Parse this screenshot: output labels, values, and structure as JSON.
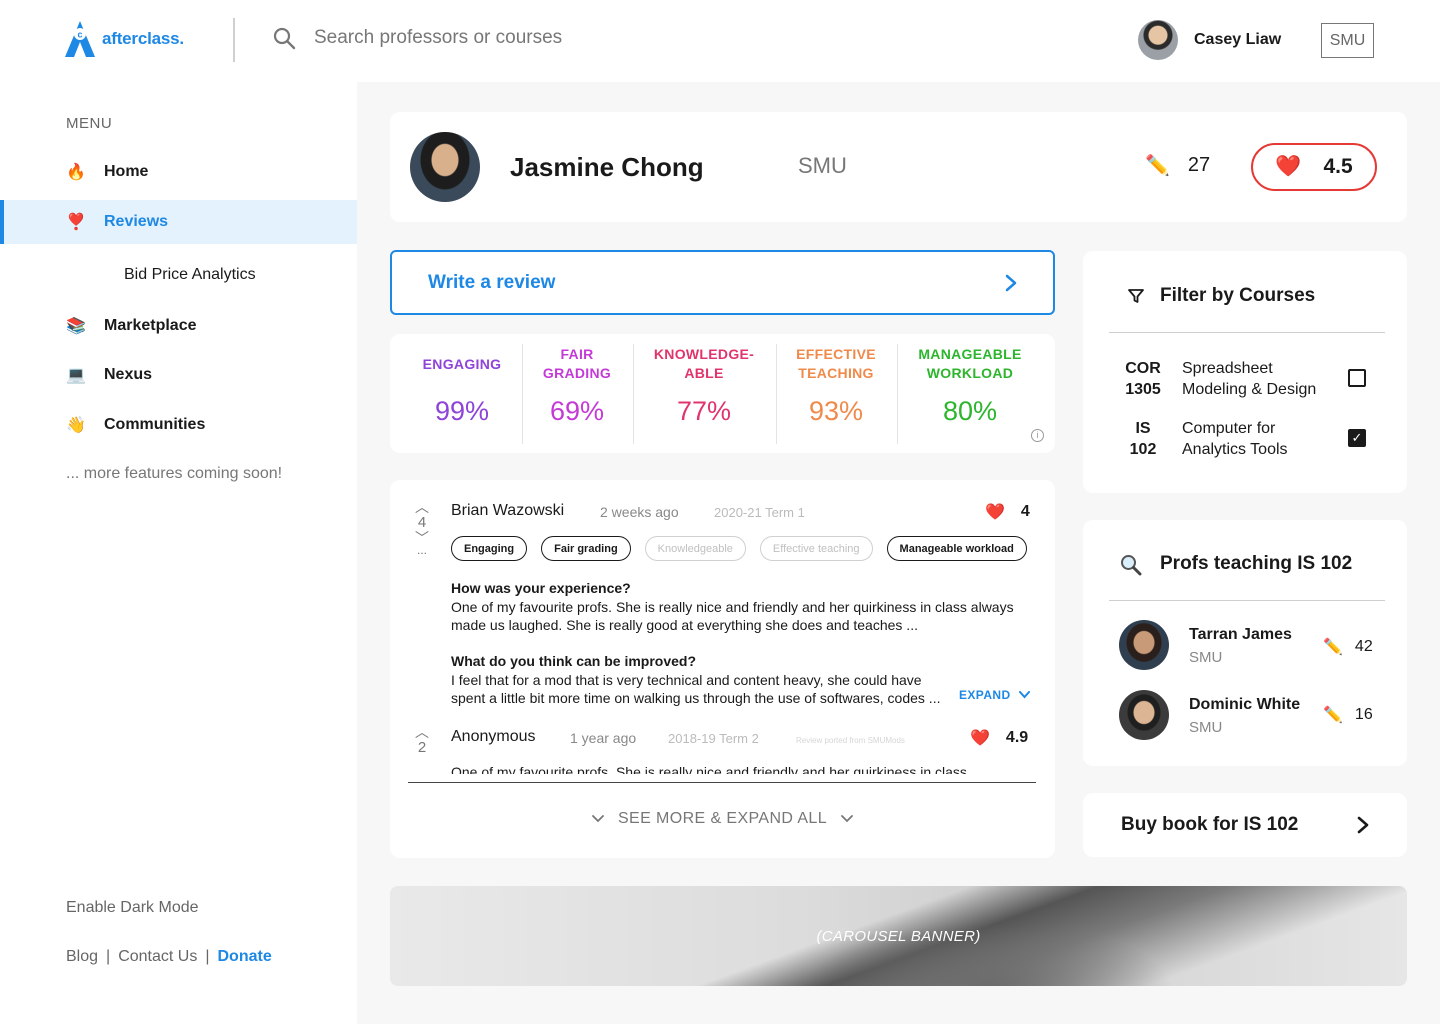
{
  "header": {
    "brand": "afterclass.",
    "search_placeholder": "Search professors or courses",
    "user_name": "Casey Liaw",
    "university": "SMU"
  },
  "sidebar": {
    "menu_label": "MENU",
    "items": [
      {
        "icon": "fire-icon",
        "glyph": "🔥",
        "label": "Home"
      },
      {
        "icon": "heart-exclamation-icon",
        "glyph": "❣️",
        "label": "Reviews",
        "active": true
      },
      {
        "icon": "books-icon",
        "glyph": "📚",
        "label": "Marketplace"
      },
      {
        "icon": "laptop-icon",
        "glyph": "💻",
        "label": "Nexus"
      },
      {
        "icon": "wave-icon",
        "glyph": "👋",
        "label": "Communities"
      }
    ],
    "sub_item": "Bid Price Analytics",
    "coming_soon": "... more features coming soon!",
    "dark_mode": "Enable Dark Mode",
    "footer": {
      "blog": "Blog",
      "sep": "|",
      "contact": "Contact Us",
      "donate": "Donate"
    }
  },
  "professor": {
    "name": "Jasmine Chong",
    "university": "SMU",
    "review_count": "27",
    "rating": "4.5"
  },
  "write_review_label": "Write a review",
  "stats": [
    {
      "label": "ENGAGING",
      "value": "99%",
      "color": "#8e44d9"
    },
    {
      "label": "FAIR GRADING",
      "value": "69%",
      "color": "#c43ad6"
    },
    {
      "label": "KNOWLEDGE-ABLE",
      "value": "77%",
      "color": "#e0356b"
    },
    {
      "label": "EFFECTIVE TEACHING",
      "value": "93%",
      "color": "#f08a4b"
    },
    {
      "label": "MANAGEABLE WORKLOAD",
      "value": "80%",
      "color": "#2db52d"
    }
  ],
  "reviews": [
    {
      "votes": "4",
      "author": "Brian Wazowski",
      "time": "2 weeks ago",
      "term": "2020-21 Term 1",
      "rating": "4",
      "tags": [
        {
          "label": "Engaging",
          "on": true
        },
        {
          "label": "Fair grading",
          "on": true
        },
        {
          "label": "Knowledgeable",
          "on": false
        },
        {
          "label": "Effective teaching",
          "on": false
        },
        {
          "label": "Manageable workload",
          "on": true
        }
      ],
      "q1": "How was your experience?",
      "a1": "One of my favourite profs. She is really nice and friendly and her quirkiness in class always made us laughed. She is really good at everything she does and teaches ...",
      "q2": "What do you think can be improved?",
      "a2": "I feel that for a mod that is very technical and content heavy, she could have spent a little bit more time on walking us through the use of softwares, codes ...",
      "expand": "EXPAND",
      "more": "..."
    },
    {
      "votes": "2",
      "author": "Anonymous",
      "time": "1 year ago",
      "term": "2018-19 Term 2",
      "ported": "Review ported from SMUMods",
      "rating": "4.9",
      "preview": "One of my favourite profs. She is really nice and friendly and her quirkiness in class"
    }
  ],
  "see_more": "SEE MORE & EXPAND ALL",
  "banner": "(CAROUSEL BANNER)",
  "filter": {
    "title": "Filter by Courses",
    "courses": [
      {
        "code_a": "COR",
        "code_b": "1305",
        "name": "Spreadsheet Modeling & Design",
        "checked": false
      },
      {
        "code_a": "IS",
        "code_b": "102",
        "name": "Computer for Analytics Tools",
        "checked": true
      }
    ]
  },
  "profs_teaching": {
    "title": "Profs teaching IS 102",
    "profs": [
      {
        "name": "Tarran James",
        "uni": "SMU",
        "count": "42"
      },
      {
        "name": "Dominic White",
        "uni": "SMU",
        "count": "16"
      }
    ]
  },
  "buy_book": "Buy book for IS 102",
  "colors": {
    "accent": "#1e88e5",
    "heart": "#e53935"
  }
}
